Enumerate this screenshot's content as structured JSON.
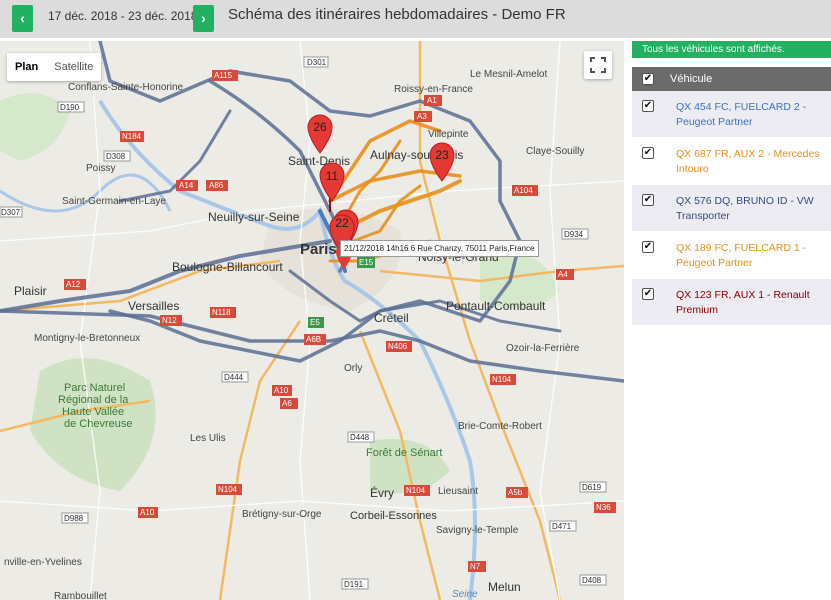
{
  "header": {
    "prev_label": "‹",
    "next_label": "›",
    "date_range": "17 déc. 2018 - 23 déc. 2018",
    "title": "Schéma des itinéraires hebdomadaires - Demo FR"
  },
  "map": {
    "map_type_buttons": [
      "Plan",
      "Satellite"
    ],
    "active_map_type": "Plan",
    "fullscreen_icon": "fullscreen-icon",
    "tooltip": "21/12/2018 14h16 6 Rue Chanzy, 75011 Paris,France",
    "markers": [
      "26",
      "11",
      "23",
      "22"
    ],
    "place_labels": {
      "conflans": "Conflans-Sainte-Honorine",
      "le_mesnil": "Le Mesnil-Amelot",
      "roissy": "Roissy-en-France",
      "villepinte": "Villepinte",
      "claye": "Claye-Souilly",
      "poissy": "Poissy",
      "saint_denis": "Saint-Denis",
      "aulnay": "Aulnay-sous-Bois",
      "saint_germain": "Saint-Germain-en-Laye",
      "neuilly": "Neuilly-sur-Seine",
      "paris": "Paris",
      "noisy": "Noisy-le-Grand",
      "plaisir": "Plaisir",
      "boulogne": "Boulogne-Billancourt",
      "versailles": "Versailles",
      "pontault": "Pontault-Combault",
      "creteil": "Créteil",
      "montigny": "Montigny-le-Bretonneux",
      "ozoir": "Ozoir-la-Ferrière",
      "orly": "Orly",
      "parc1": "Parc Naturel",
      "parc2": "Régional de la",
      "parc3": "Haute Vallée",
      "parc4": "de Chevreuse",
      "les_ulis": "Les Ulis",
      "brie": "Brie-Comte-Robert",
      "senart": "Forêt de Sénart",
      "evry": "Évry",
      "lieusaint": "Lieusaint",
      "bretigny": "Brétigny-sur-Orge",
      "corbeil": "Corbeil-Essonnes",
      "savigny": "Savigny-le-Temple",
      "rambouillet": "Rambouillet",
      "melun": "Melun",
      "nonville": "nville-en-Yvelines",
      "seine": "Seine"
    },
    "road_labels": {
      "d301": "D301",
      "a115": "A115",
      "a1": "A1",
      "d190": "D190",
      "a3": "A3",
      "n184": "N184",
      "d308": "D308",
      "a14": "A14",
      "a86": "A86",
      "a104": "A104",
      "d307": "D307",
      "d934": "D934",
      "a15": "A15",
      "e15": "E15",
      "a4": "A4",
      "n12": "N12",
      "a12": "A12",
      "e5": "E5",
      "n118": "N118",
      "a6b": "A6B",
      "n406": "N406",
      "n104": "N104",
      "d444": "D444",
      "a10": "A10",
      "a6": "A6",
      "d448": "D448",
      "a5b": "A5b",
      "d619": "D619",
      "d988": "D988",
      "n36": "N36",
      "d471": "D471",
      "d191": "D191",
      "d408": "D408",
      "n7": "N7",
      "a5": "A5"
    }
  },
  "panel": {
    "status": "Tous les véhicules sont affichés.",
    "column_header": "Véhicule",
    "vehicles": [
      {
        "name": "QX 454 FC, FUELCARD 2 - Peugeot Partner",
        "color": "#3b73c4",
        "checked": "✔"
      },
      {
        "name": "QX 687 FR, AUX 2 - Mercedes Intouro",
        "color": "#e8901a",
        "checked": "✔"
      },
      {
        "name": "QX 576 DQ, BRUNO ID - VW Transporter",
        "color": "#3a4a7a",
        "checked": "✔"
      },
      {
        "name": "QX 189 FC, FUELCARD 1 - Peugeot Partner",
        "color": "#e8901a",
        "checked": "✔"
      },
      {
        "name": "QX 123 FR, AUX 1 - Renault Premium",
        "color": "#8b0000",
        "checked": "✔"
      }
    ]
  }
}
